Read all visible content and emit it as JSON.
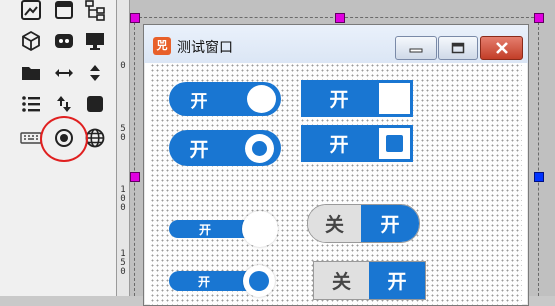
{
  "palette": {
    "icons": [
      "image-icon",
      "window-icon",
      "tree-icon",
      "cube-icon",
      "gamepad-icon",
      "monitor-icon",
      "folder-icon",
      "horizontal-arrows-icon",
      "vertical-arrows-icon",
      "list-icon",
      "swap-arrows-icon",
      "square-icon",
      "keyboard-icon",
      "radio-button-icon",
      "globe-icon"
    ],
    "selected": "radio-button-icon",
    "highlight_color": "#e02020"
  },
  "ruler": {
    "labels": [
      "0",
      "5\n0",
      "1\n0\n0",
      "1\n5\n0"
    ]
  },
  "window": {
    "app_icon_text": "兕",
    "title": "测试窗口"
  },
  "toggles": {
    "on_label": "开",
    "off_label": "关",
    "accent_color": "#1976d2",
    "items": [
      {
        "style": "pill-knob",
        "state": "on"
      },
      {
        "style": "box-square",
        "state": "on"
      },
      {
        "style": "pill-ring",
        "state": "on"
      },
      {
        "style": "box-square-ring",
        "state": "on"
      },
      {
        "style": "thin-pill-knob",
        "state": "on"
      },
      {
        "style": "segmented-pill",
        "state": "on"
      },
      {
        "style": "thin-pill-ring",
        "state": "on"
      },
      {
        "style": "segmented-box",
        "state": "on"
      }
    ]
  }
}
